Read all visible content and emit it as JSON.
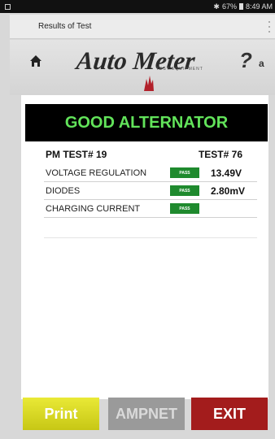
{
  "status_bar": {
    "bluetooth_icon": "bluetooth-icon",
    "battery_text": "67%",
    "time": "8:49 AM",
    "left_icon": "image-icon"
  },
  "title_bar": {
    "title": "Results of Test"
  },
  "brand": {
    "logo_text": "Auto Meter",
    "logo_sub": "TEST EQUIPMENT",
    "help_sub": "a",
    "icons": [
      "home-icon",
      "flame-icon",
      "help-icon"
    ]
  },
  "results": {
    "banner": "GOOD ALTERNATOR",
    "banner_color": "#62e35a",
    "pm_test": "PM TEST# 19",
    "test_number": "TEST# 76",
    "rows": [
      {
        "label": "VOLTAGE REGULATION",
        "status": "PASS",
        "value": "13.49V"
      },
      {
        "label": "DIODES",
        "status": "PASS",
        "value": "2.80mV"
      },
      {
        "label": "CHARGING CURRENT",
        "status": "PASS",
        "value": ""
      }
    ]
  },
  "buttons": {
    "print": "Print",
    "ampnet": "AMPNET",
    "exit": "EXIT"
  },
  "colors": {
    "pass_green": "#1f8a2e",
    "print_yellow": "#d8d826",
    "exit_red": "#a31c1c",
    "ampnet_gray": "#9a9a9a"
  }
}
